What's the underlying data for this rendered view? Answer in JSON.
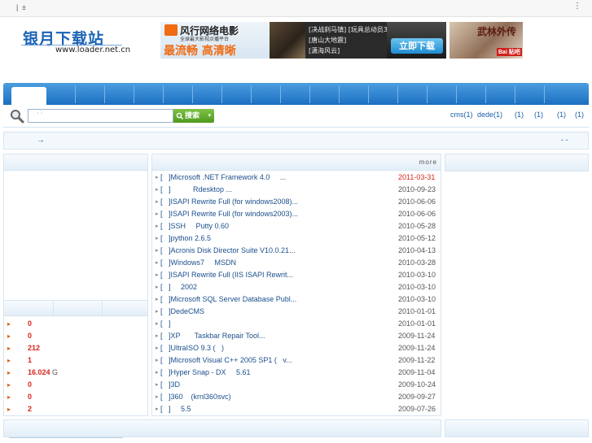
{
  "topbar": {
    "separator": "|",
    "plus": "±",
    "menu": "⋮"
  },
  "logo": {
    "name": "银月下载站",
    "url": "www.loader.net.cn"
  },
  "banner1": {
    "brand": "风行网络电影",
    "tagline": "全球最大影视点播平台",
    "slogan": "最流畅 高清晰",
    "links": [
      "[决战刹马镇] [玩具总动员3]",
      "[唐山大地震]",
      "[潇海风云]"
    ],
    "button": "立即下载"
  },
  "banner2": {
    "title": "武林外传",
    "badge": "Bai 贴吧"
  },
  "search": {
    "placeholder": "` `",
    "button": "搜索",
    "arrow": "▾"
  },
  "hot_links": [
    "cms(1)",
    "dede(1)",
    "(1)",
    "(1)",
    "(1)",
    "(1)"
  ],
  "notice": {
    "arrow": "→",
    "trailing": "-  -"
  },
  "stats": [
    {
      "value": "0",
      "unit": ""
    },
    {
      "value": "0",
      "unit": ""
    },
    {
      "value": "212",
      "unit": ""
    },
    {
      "value": "1",
      "unit": ""
    },
    {
      "value": "16.024",
      "unit": "G"
    },
    {
      "value": "0",
      "unit": ""
    },
    {
      "value": "0",
      "unit": ""
    },
    {
      "value": "2",
      "unit": ""
    }
  ],
  "more_label": "more",
  "articles": [
    {
      "title": "[   ]Microsoft .NET Framework 4.0     ...",
      "date": "2011-03-31",
      "new": true
    },
    {
      "title": "[   ]           Rdesktop ...",
      "date": "2010-09-23"
    },
    {
      "title": "[   ]ISAPI Rewrite Full (for windows2008)...",
      "date": "2010-06-06"
    },
    {
      "title": "[   ]ISAPI Rewrite Full (for windows2003)...",
      "date": "2010-06-06"
    },
    {
      "title": "[   ]SSH     Putty 0.60",
      "date": "2010-05-28"
    },
    {
      "title": "[   ]python 2.6.5",
      "date": "2010-05-12"
    },
    {
      "title": "[   ]Acronis Disk Director Suite V10.0.21...",
      "date": "2010-04-13"
    },
    {
      "title": "[   ]Windows7     MSDN",
      "date": "2010-03-28"
    },
    {
      "title": "[   ]ISAPI Rewrite Full (IIS ISAPI Rewrit...",
      "date": "2010-03-10"
    },
    {
      "title": "[   ]     2002",
      "date": "2010-03-10"
    },
    {
      "title": "[   ]Microsoft SQL Server Database Publ...",
      "date": "2010-03-10"
    },
    {
      "title": "[   ]DedeCMS",
      "date": "2010-01-01"
    },
    {
      "title": "[   ]",
      "date": "2010-01-01"
    },
    {
      "title": "[   ]XP       Taskbar Repair Tool...",
      "date": "2009-11-24"
    },
    {
      "title": "[   ]UltraISO 9.3 (   )",
      "date": "2009-11-24"
    },
    {
      "title": "[   ]Microsoft Visual C++ 2005 SP1 (   v...",
      "date": "2009-11-22"
    },
    {
      "title": "[   ]Hyper Snap - DX     5.61",
      "date": "2009-11-04"
    },
    {
      "title": "[   ]3D",
      "date": "2009-10-24"
    },
    {
      "title": "[   ]360    (krnl360svc)",
      "date": "2009-09-27"
    },
    {
      "title": "[   ]     5.5",
      "date": "2009-07-26"
    }
  ],
  "colors": {
    "nav_blue": "#1b6fc0",
    "link": "#1b4f8c",
    "accent_red": "#d9261c",
    "search_green": "#4f9a1e"
  }
}
